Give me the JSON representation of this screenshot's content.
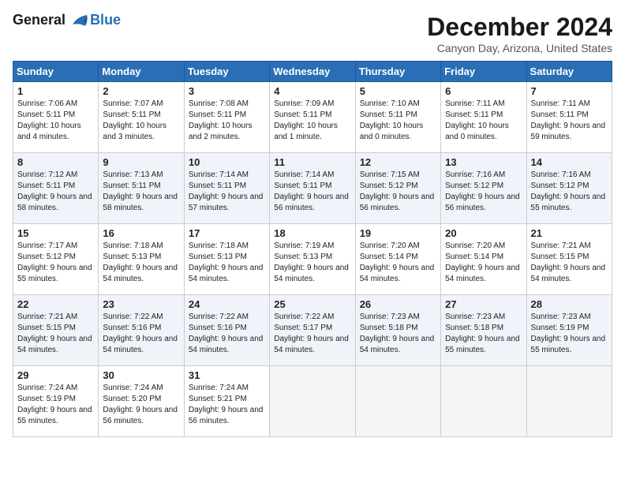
{
  "header": {
    "logo_line1": "General",
    "logo_line2": "Blue",
    "month": "December 2024",
    "location": "Canyon Day, Arizona, United States"
  },
  "weekdays": [
    "Sunday",
    "Monday",
    "Tuesday",
    "Wednesday",
    "Thursday",
    "Friday",
    "Saturday"
  ],
  "weeks": [
    [
      {
        "day": 1,
        "sunrise": "7:06 AM",
        "sunset": "5:11 PM",
        "daylight": "10 hours and 4 minutes."
      },
      {
        "day": 2,
        "sunrise": "7:07 AM",
        "sunset": "5:11 PM",
        "daylight": "10 hours and 3 minutes."
      },
      {
        "day": 3,
        "sunrise": "7:08 AM",
        "sunset": "5:11 PM",
        "daylight": "10 hours and 2 minutes."
      },
      {
        "day": 4,
        "sunrise": "7:09 AM",
        "sunset": "5:11 PM",
        "daylight": "10 hours and 1 minute."
      },
      {
        "day": 5,
        "sunrise": "7:10 AM",
        "sunset": "5:11 PM",
        "daylight": "10 hours and 0 minutes."
      },
      {
        "day": 6,
        "sunrise": "7:11 AM",
        "sunset": "5:11 PM",
        "daylight": "10 hours and 0 minutes."
      },
      {
        "day": 7,
        "sunrise": "7:11 AM",
        "sunset": "5:11 PM",
        "daylight": "9 hours and 59 minutes."
      }
    ],
    [
      {
        "day": 8,
        "sunrise": "7:12 AM",
        "sunset": "5:11 PM",
        "daylight": "9 hours and 58 minutes."
      },
      {
        "day": 9,
        "sunrise": "7:13 AM",
        "sunset": "5:11 PM",
        "daylight": "9 hours and 58 minutes."
      },
      {
        "day": 10,
        "sunrise": "7:14 AM",
        "sunset": "5:11 PM",
        "daylight": "9 hours and 57 minutes."
      },
      {
        "day": 11,
        "sunrise": "7:14 AM",
        "sunset": "5:11 PM",
        "daylight": "9 hours and 56 minutes."
      },
      {
        "day": 12,
        "sunrise": "7:15 AM",
        "sunset": "5:12 PM",
        "daylight": "9 hours and 56 minutes."
      },
      {
        "day": 13,
        "sunrise": "7:16 AM",
        "sunset": "5:12 PM",
        "daylight": "9 hours and 56 minutes."
      },
      {
        "day": 14,
        "sunrise": "7:16 AM",
        "sunset": "5:12 PM",
        "daylight": "9 hours and 55 minutes."
      }
    ],
    [
      {
        "day": 15,
        "sunrise": "7:17 AM",
        "sunset": "5:12 PM",
        "daylight": "9 hours and 55 minutes."
      },
      {
        "day": 16,
        "sunrise": "7:18 AM",
        "sunset": "5:13 PM",
        "daylight": "9 hours and 54 minutes."
      },
      {
        "day": 17,
        "sunrise": "7:18 AM",
        "sunset": "5:13 PM",
        "daylight": "9 hours and 54 minutes."
      },
      {
        "day": 18,
        "sunrise": "7:19 AM",
        "sunset": "5:13 PM",
        "daylight": "9 hours and 54 minutes."
      },
      {
        "day": 19,
        "sunrise": "7:20 AM",
        "sunset": "5:14 PM",
        "daylight": "9 hours and 54 minutes."
      },
      {
        "day": 20,
        "sunrise": "7:20 AM",
        "sunset": "5:14 PM",
        "daylight": "9 hours and 54 minutes."
      },
      {
        "day": 21,
        "sunrise": "7:21 AM",
        "sunset": "5:15 PM",
        "daylight": "9 hours and 54 minutes."
      }
    ],
    [
      {
        "day": 22,
        "sunrise": "7:21 AM",
        "sunset": "5:15 PM",
        "daylight": "9 hours and 54 minutes."
      },
      {
        "day": 23,
        "sunrise": "7:22 AM",
        "sunset": "5:16 PM",
        "daylight": "9 hours and 54 minutes."
      },
      {
        "day": 24,
        "sunrise": "7:22 AM",
        "sunset": "5:16 PM",
        "daylight": "9 hours and 54 minutes."
      },
      {
        "day": 25,
        "sunrise": "7:22 AM",
        "sunset": "5:17 PM",
        "daylight": "9 hours and 54 minutes."
      },
      {
        "day": 26,
        "sunrise": "7:23 AM",
        "sunset": "5:18 PM",
        "daylight": "9 hours and 54 minutes."
      },
      {
        "day": 27,
        "sunrise": "7:23 AM",
        "sunset": "5:18 PM",
        "daylight": "9 hours and 55 minutes."
      },
      {
        "day": 28,
        "sunrise": "7:23 AM",
        "sunset": "5:19 PM",
        "daylight": "9 hours and 55 minutes."
      }
    ],
    [
      {
        "day": 29,
        "sunrise": "7:24 AM",
        "sunset": "5:19 PM",
        "daylight": "9 hours and 55 minutes."
      },
      {
        "day": 30,
        "sunrise": "7:24 AM",
        "sunset": "5:20 PM",
        "daylight": "9 hours and 56 minutes."
      },
      {
        "day": 31,
        "sunrise": "7:24 AM",
        "sunset": "5:21 PM",
        "daylight": "9 hours and 56 minutes."
      },
      null,
      null,
      null,
      null
    ]
  ]
}
